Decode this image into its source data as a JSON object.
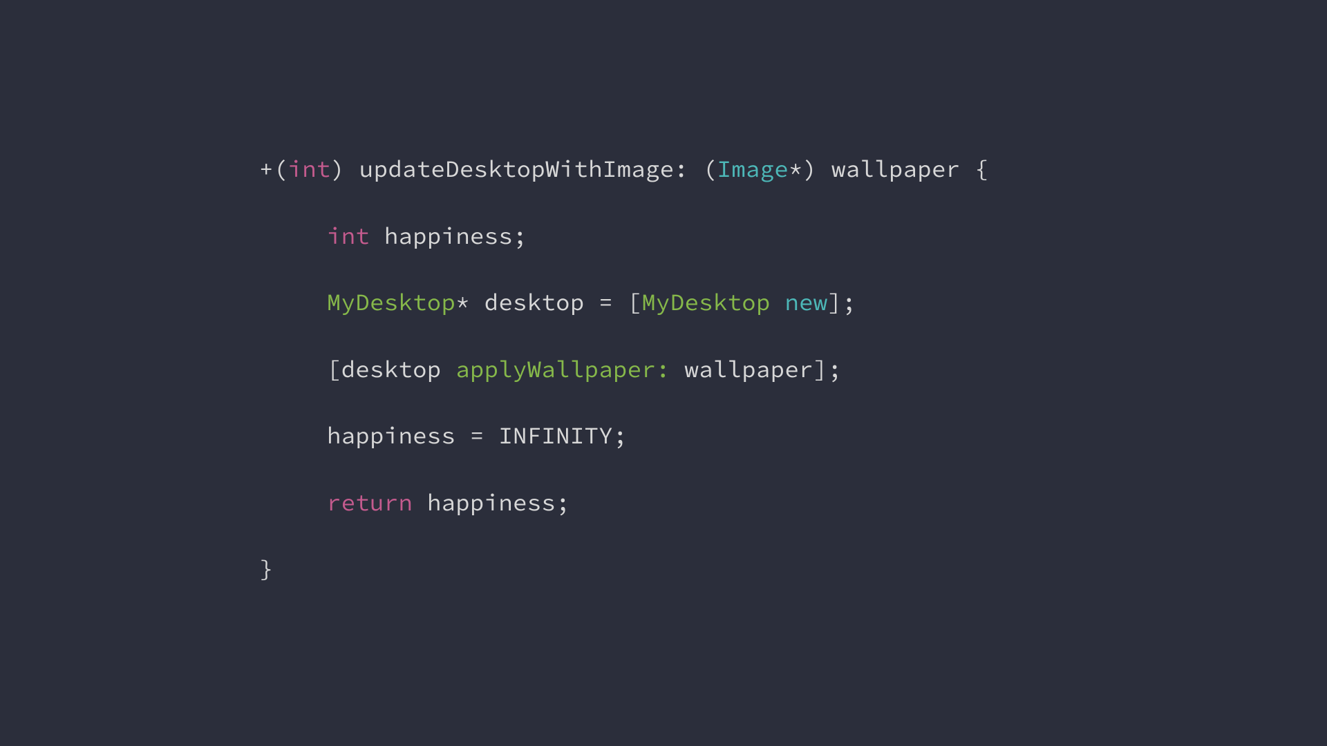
{
  "code": {
    "line1": {
      "plus": "+",
      "lparen1": "(",
      "int": "int",
      "rparen1": ")",
      "space1": " ",
      "method": "updateDesktopWithImage:",
      "space2": " ",
      "lparen2": "(",
      "image": "Image",
      "star": "*",
      "rparen2": ")",
      "space3": " ",
      "param": "wallpaper",
      "space4": " ",
      "lbrace": "{"
    },
    "line2": {
      "int": "int",
      "space": " ",
      "var": "happiness",
      "semi": ";"
    },
    "line3": {
      "class1": "MyDesktop",
      "star": "*",
      "space1": " ",
      "var": "desktop",
      "space2": " ",
      "eq": "=",
      "space3": " ",
      "lbracket": "[",
      "class2": "MyDesktop",
      "space4": " ",
      "new": "new",
      "rbracket": "]",
      "semi": ";"
    },
    "line4": {
      "lbracket": "[",
      "var": "desktop",
      "space1": " ",
      "message": "applyWallpaper:",
      "space2": " ",
      "param": "wallpaper",
      "rbracket": "]",
      "semi": ";"
    },
    "line5": {
      "var": "happiness",
      "space1": " ",
      "eq": "=",
      "space2": " ",
      "const": "INFINITY",
      "semi": ";"
    },
    "line6": {
      "return": "return",
      "space": " ",
      "var": "happiness",
      "semi": ";"
    },
    "line7": {
      "rbrace": "}"
    }
  }
}
